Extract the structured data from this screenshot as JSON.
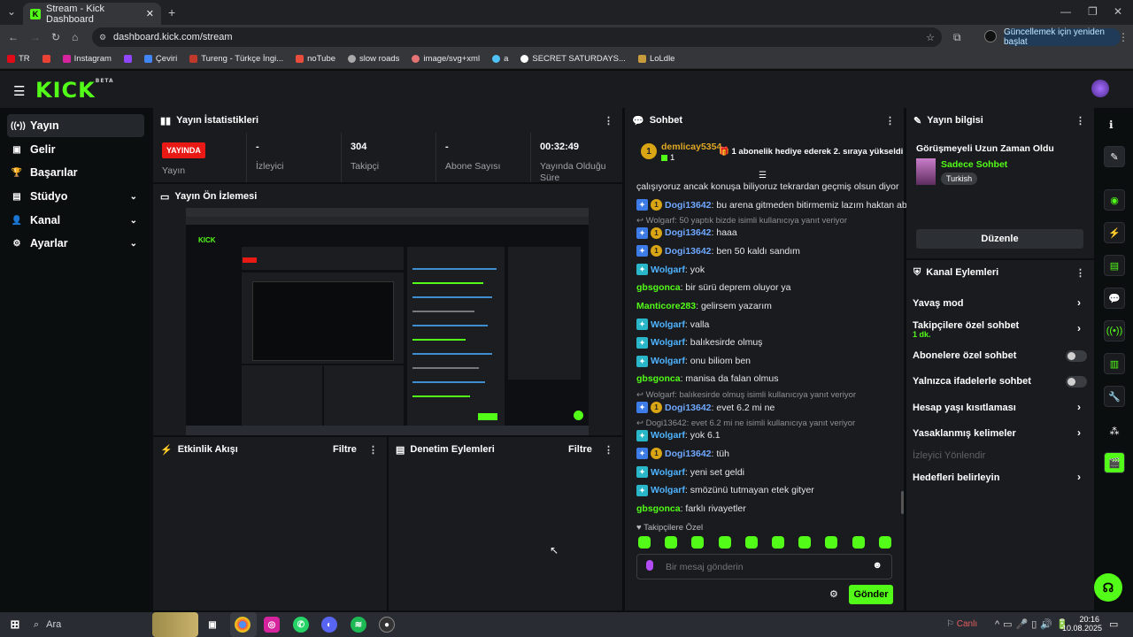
{
  "browser": {
    "tab_title": "Stream - Kick Dashboard",
    "url": "dashboard.kick.com/stream",
    "update_label": "Güncellemek için yeniden başlat",
    "bookmarks": [
      "TR",
      "",
      "Instagram",
      "",
      "Çeviri",
      "Tureng - Türkçe İngi...",
      "noTube",
      "slow roads",
      "image/svg+xml",
      "a",
      "SECRET SATURDAYS...",
      "LoLdle"
    ]
  },
  "logo": {
    "text": "KICK",
    "beta": "BETA"
  },
  "sidebar": {
    "items": [
      {
        "label": "Yayın",
        "icon": "((•))"
      },
      {
        "label": "Gelir",
        "icon": "▣"
      },
      {
        "label": "Başarılar",
        "icon": "🏆"
      },
      {
        "label": "Stüdyo",
        "icon": "▤"
      },
      {
        "label": "Kanal",
        "icon": "👤"
      },
      {
        "label": "Ayarlar",
        "icon": "⚙"
      }
    ]
  },
  "stats": {
    "title": "Yayın İstatistikleri",
    "live_badge": "YAYINDA",
    "cells": [
      {
        "value": "",
        "label": "Yayın"
      },
      {
        "value": "-",
        "label": "İzleyici"
      },
      {
        "value": "304",
        "label": "Takipçi"
      },
      {
        "value": "-",
        "label": "Abone Sayısı"
      },
      {
        "value": "00:32:49",
        "label": "Yayında Olduğu Süre"
      }
    ]
  },
  "preview": {
    "title": "Yayın Ön İzlemesi"
  },
  "activity": {
    "title": "Etkinlik Akışı",
    "filter": "Filtre"
  },
  "moderation": {
    "title": "Denetim Eylemleri",
    "filter": "Filtre"
  },
  "chat": {
    "title": "Sohbet",
    "pinned": {
      "user": "demlicay5354",
      "count": "1",
      "badge": "1",
      "text": "1 abonelik hediye ederek 2. sıraya yükseldi"
    },
    "first_line": "çalışıyoruz ancak konuşa biliyoruz tekrardan geçmiş olsun diyor",
    "messages": [
      {
        "type": "msg",
        "user": "Dogi13642",
        "text": ": bu arena gitmeden bitirmemiz lazım haktan abi",
        "badges": [
          "blue",
          "gold"
        ],
        "color": "#6fa8ff"
      },
      {
        "type": "reply",
        "text": "Wolgarf: 50 yaptık bizde isimli kullanıcıya yanıt veriyor"
      },
      {
        "type": "msg",
        "user": "Dogi13642",
        "text": ": haaa",
        "badges": [
          "blue",
          "gold"
        ],
        "color": "#6fa8ff"
      },
      {
        "type": "msg",
        "user": "Dogi13642",
        "text": ": ben 50 kaldı sandım",
        "badges": [
          "blue",
          "gold"
        ],
        "color": "#6fa8ff"
      },
      {
        "type": "msg",
        "user": "Wolgarf",
        "text": ": yok",
        "badges": [
          "teal"
        ],
        "color": "#4fb3ff"
      },
      {
        "type": "msg",
        "user": "gbsgonca",
        "text": ": bir sürü deprem oluyor ya",
        "badges": [],
        "color": "#53fc18"
      },
      {
        "type": "msg",
        "user": "Manticore283",
        "text": ": gelirsem yazarım",
        "badges": [],
        "color": "#53fc18"
      },
      {
        "type": "msg",
        "user": "Wolgarf",
        "text": ": valla",
        "badges": [
          "teal"
        ],
        "color": "#4fb3ff"
      },
      {
        "type": "msg",
        "user": "Wolgarf",
        "text": ": balıkesirde olmuş",
        "badges": [
          "teal"
        ],
        "color": "#4fb3ff"
      },
      {
        "type": "msg",
        "user": "Wolgarf",
        "text": ": onu biliom ben",
        "badges": [
          "teal"
        ],
        "color": "#4fb3ff"
      },
      {
        "type": "msg",
        "user": "gbsgonca",
        "text": ": manisa da falan olmus",
        "badges": [],
        "color": "#53fc18"
      },
      {
        "type": "reply",
        "text": "Wolgarf: balıkesirde olmuş isimli kullanıcıya yanıt veriyor"
      },
      {
        "type": "msg",
        "user": "Dogi13642",
        "text": ": evet 6.2 mi ne",
        "badges": [
          "blue",
          "gold"
        ],
        "color": "#6fa8ff"
      },
      {
        "type": "reply",
        "text": "Dogi13642: evet 6.2 mi ne isimli kullanıcıya yanıt veriyor"
      },
      {
        "type": "msg",
        "user": "Wolgarf",
        "text": ": yok 6.1",
        "badges": [
          "teal"
        ],
        "color": "#4fb3ff"
      },
      {
        "type": "msg",
        "user": "Dogi13642",
        "text": ": tüh",
        "badges": [
          "blue",
          "gold"
        ],
        "color": "#6fa8ff"
      },
      {
        "type": "msg",
        "user": "Wolgarf",
        "text": ": yeni set geldi",
        "badges": [
          "teal"
        ],
        "color": "#4fb3ff"
      },
      {
        "type": "msg",
        "user": "Wolgarf",
        "text": ": smözünü tutmayan etek gityer",
        "badges": [
          "teal"
        ],
        "color": "#4fb3ff"
      },
      {
        "type": "msg",
        "user": "gbsgonca",
        "text": ": farklı rivayetler",
        "badges": [],
        "color": "#53fc18"
      }
    ],
    "followers_only": "Takipçilere Özel",
    "input_placeholder": "Bir mesaj gönderin",
    "send_label": "Gönder"
  },
  "stream_info": {
    "title": "Yayın bilgisi",
    "stream_title": "Görüşmeyeli Uzun Zaman Oldu",
    "category": "Sadece Sohbet",
    "tag": "Turkish",
    "edit_label": "Düzenle"
  },
  "channel_actions": {
    "title": "Kanal Eylemleri",
    "items": [
      {
        "label": "Yavaş mod",
        "sub": "",
        "control": "chevron"
      },
      {
        "label": "Takipçilere özel sohbet",
        "sub": "1 dk.",
        "control": "chevron"
      },
      {
        "label": "Abonelere özel sohbet",
        "sub": "",
        "control": "toggle"
      },
      {
        "label": "Yalnızca ifadelerle sohbet",
        "sub": "",
        "control": "toggle"
      },
      {
        "label": "Hesap yaşı kısıtlaması",
        "sub": "",
        "control": "chevron"
      },
      {
        "label": "Yasaklanmış kelimeler",
        "sub": "",
        "control": "chevron"
      },
      {
        "label": "İzleyici Yönlendir",
        "sub": "",
        "control": "disabled"
      },
      {
        "label": "Hedefleri belirleyin",
        "sub": "",
        "control": "chevron"
      }
    ]
  },
  "taskbar": {
    "search": "Ara",
    "live": "Canlı",
    "time": "20:16",
    "date": "10.08.2025"
  }
}
